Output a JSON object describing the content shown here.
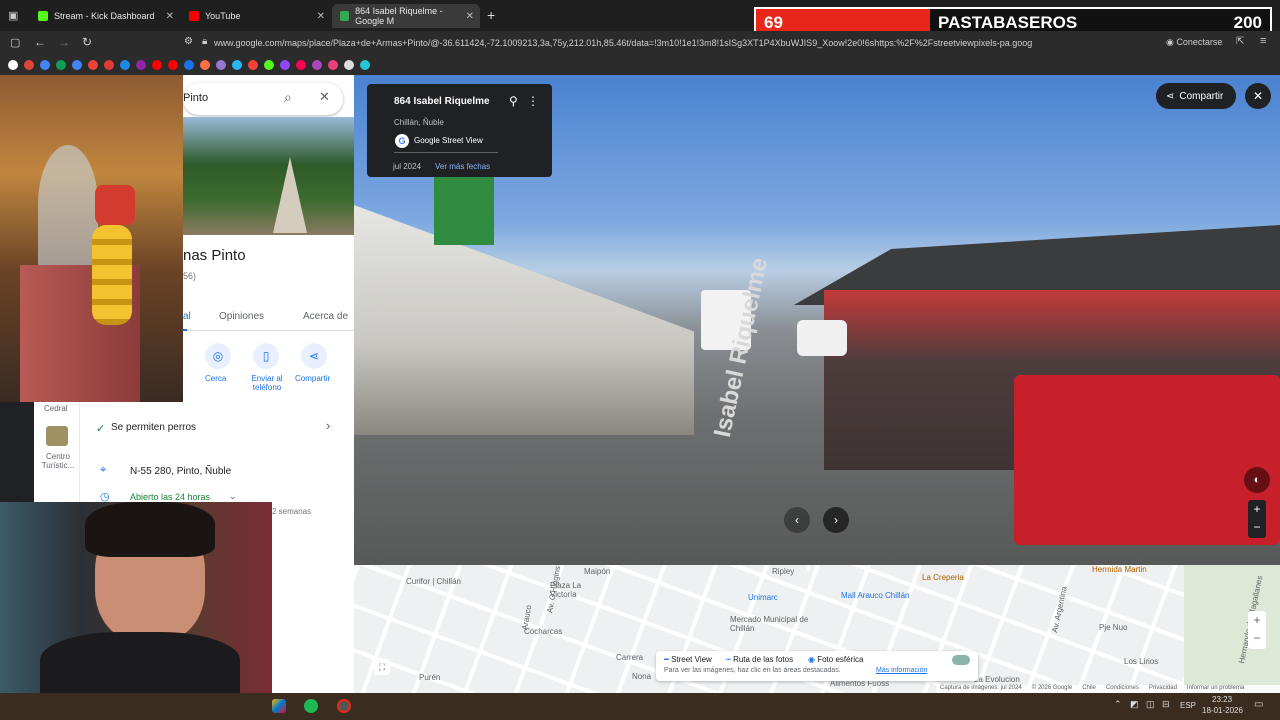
{
  "tabs": [
    {
      "label": "Stream - Kick Dashboard",
      "color": "#53fc18"
    },
    {
      "label": "YouTube",
      "color": "#ff0000"
    },
    {
      "label": "864 Isabel Riquelme - Google M",
      "color": "#34a853"
    }
  ],
  "address": {
    "url": "www.google.com/maps/place/Plaza+de+Armas+Pinto/@-36.611424,-72.1009213,3a,75y,212.01h,85.46t/data=!3m10!1e1!3m8!1sISg3XT1P4XbuWJIS9_Xoow!2e0!6shttps:%2F%2Fstreetviewpixels-pa.goog",
    "conectarse": "Conectarse"
  },
  "overlay": {
    "score_left": "69",
    "team": "PASTABASEROS",
    "score_right": "200",
    "left_color": "#e8261a"
  },
  "search": {
    "value": "Pinto"
  },
  "place": {
    "name": "nas Pinto",
    "reviews": "56)"
  },
  "tabs_panel": [
    "al",
    "Opiniones",
    "Acerca de"
  ],
  "actions": [
    {
      "label": "r"
    },
    {
      "label": "Cerca"
    },
    {
      "label": "Enviar al teléfono"
    },
    {
      "label": "Compartir"
    }
  ],
  "amenity": "Se permiten perros",
  "address_line": "N-55 280, Pinto, Ñuble",
  "hours": "Abierto las 24 horas",
  "weeks": "2 semanas",
  "side_places": [
    {
      "label": "Cedral"
    },
    {
      "label": "Centro Turístic..."
    }
  ],
  "sv_card": {
    "title": "864 Isabel Riquelme",
    "sub": "Chillán, Ñuble",
    "provider": "Google Street View",
    "date": "jul 2024",
    "more": "Ver más fechas"
  },
  "share": "Compartir",
  "road_label": "Isabel Riquelme",
  "map": {
    "labels": [
      "Curifor | Chillán",
      "Plaza La Victoria",
      "Ripley",
      "Unimarc",
      "Mall Arauco Chillán",
      "La Creperia",
      "Hermida Martin",
      "Mercado Municipal de Chillán",
      "Cocharcas",
      "Carrera",
      "Purén",
      "Nona",
      "Maipón",
      "Av. O'Higgins",
      "Arauco",
      "Av. Argentina",
      "Hernando de Magallanes",
      "Pje Nuo",
      "Los Lirios",
      "La Evolucion",
      "Alimentos Fuoss"
    ],
    "legend": {
      "sv": "Street View",
      "ruta": "Ruta de las fotos",
      "esf": "Foto esférica",
      "hint": "Para ver las imágenes, haz clic en las áreas destacadas.",
      "more": "Más información"
    },
    "footer": [
      "Captura de imágenes: jul 2024",
      "© 2026 Google",
      "Chile",
      "Condiciones",
      "Privacidad",
      "Informar un problema"
    ]
  },
  "tray": {
    "lang": "ESP",
    "time": "23:23",
    "date": "18-01-2026"
  }
}
